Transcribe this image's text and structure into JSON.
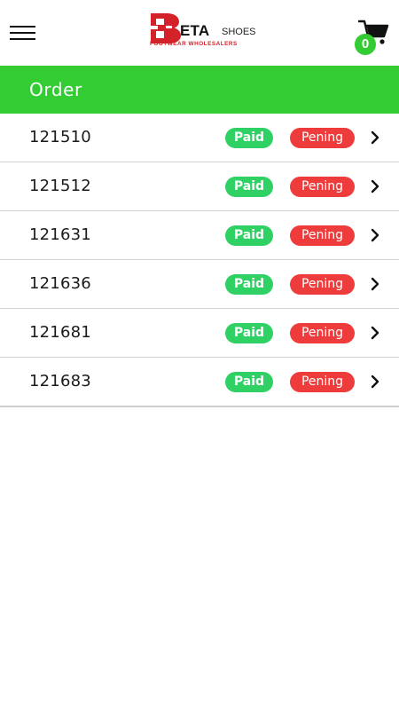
{
  "header": {
    "menu_icon": "hamburger-menu-icon",
    "logo": {
      "letter": "B",
      "word": "ETA",
      "suffix": "SHOES",
      "tagline": "FOOTWEAR WHOLESALERS"
    },
    "cart": {
      "icon": "shopping-cart-icon",
      "count": "0"
    }
  },
  "page": {
    "title": "Order"
  },
  "orders": [
    {
      "id": "121510",
      "payment": "Paid",
      "status": "Pening"
    },
    {
      "id": "121512",
      "payment": "Paid",
      "status": "Pening"
    },
    {
      "id": "121631",
      "payment": "Paid",
      "status": "Pening"
    },
    {
      "id": "121636",
      "payment": "Paid",
      "status": "Pening"
    },
    {
      "id": "121681",
      "payment": "Paid",
      "status": "Pening"
    },
    {
      "id": "121683",
      "payment": "Paid",
      "status": "Pening"
    }
  ],
  "colors": {
    "accent_green": "#33cc33",
    "paid_green": "#2fd165",
    "pending_red": "#ee3b3b",
    "brand_red": "#d3222a"
  }
}
